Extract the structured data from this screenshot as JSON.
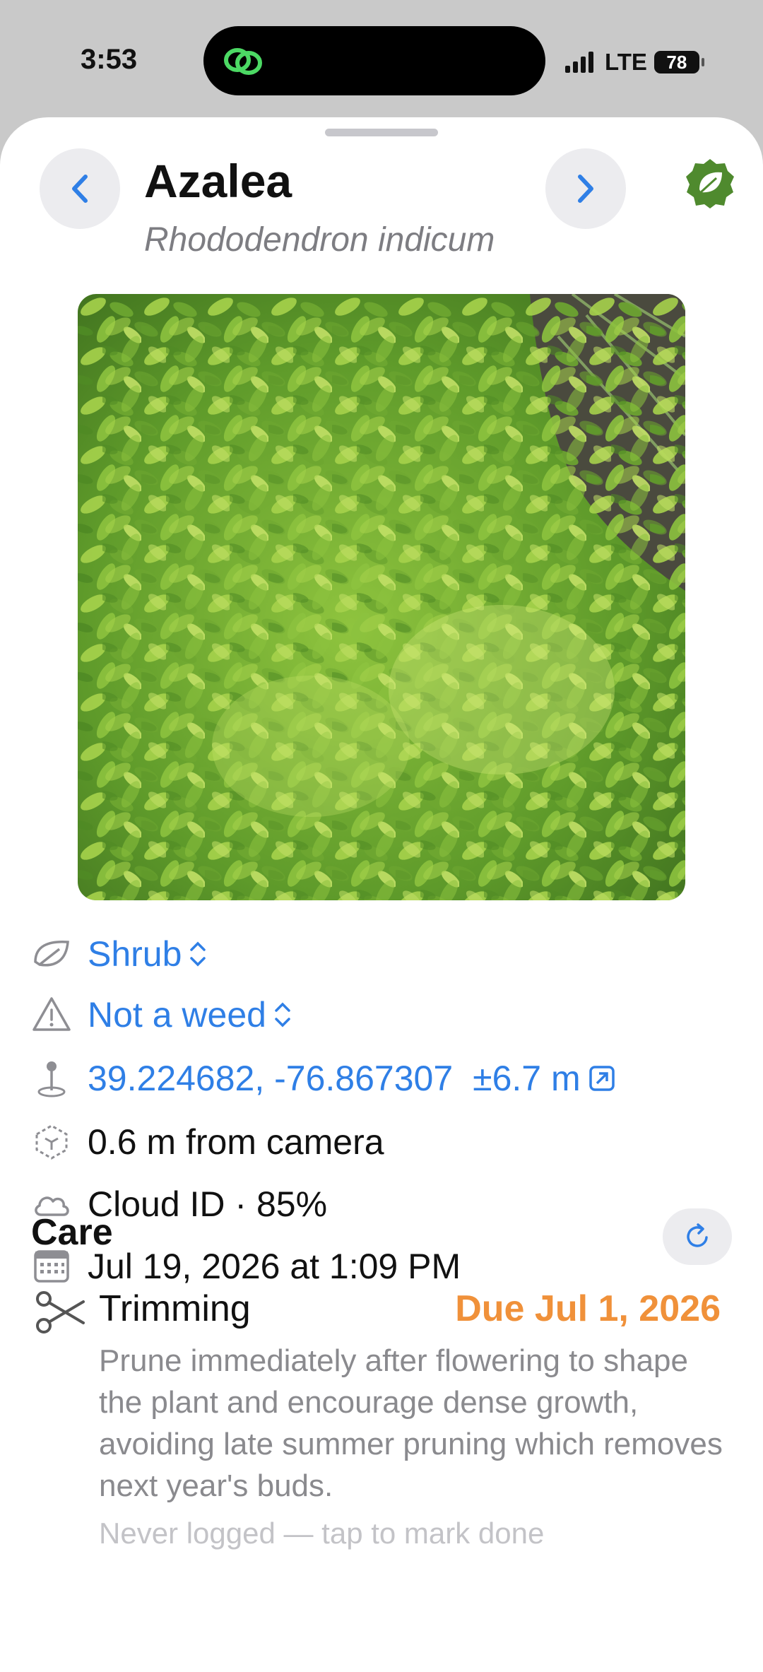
{
  "status_bar": {
    "time": "3:53",
    "network": "LTE",
    "battery": "78"
  },
  "plant": {
    "name": "Azalea",
    "scientific_name": "Rhododendron indicum"
  },
  "details": {
    "type": "Shrub",
    "weed_status": "Not a weed",
    "coordinates": "39.224682, -76.867307",
    "accuracy": "±6.7 m",
    "distance": "0.6 m from camera",
    "identification": "Cloud ID · 85%",
    "date": "Jul 19, 2026 at 1:09 PM"
  },
  "care": {
    "title": "Care",
    "tasks": [
      {
        "name": "Trimming",
        "due": "Due Jul 1, 2026",
        "description": "Prune immediately after flowering to shape the plant and encourage dense growth, avoiding late summer pruning which removes next year's buds.",
        "status": "Never logged — tap to mark done"
      }
    ]
  },
  "icons": {
    "back": "chevron-left-icon",
    "forward": "chevron-right-icon",
    "badge": "leaf-badge-icon",
    "type": "leaf-icon",
    "weed": "warning-icon",
    "location": "pin-icon",
    "distance": "ar-distance-icon",
    "cloud": "cloud-icon",
    "date": "calendar-icon",
    "refresh": "refresh-icon",
    "trim": "scissors-icon"
  },
  "colors": {
    "accent": "#2f7fe6",
    "due": "#f0913a",
    "badge_green": "#4f8a2e"
  }
}
